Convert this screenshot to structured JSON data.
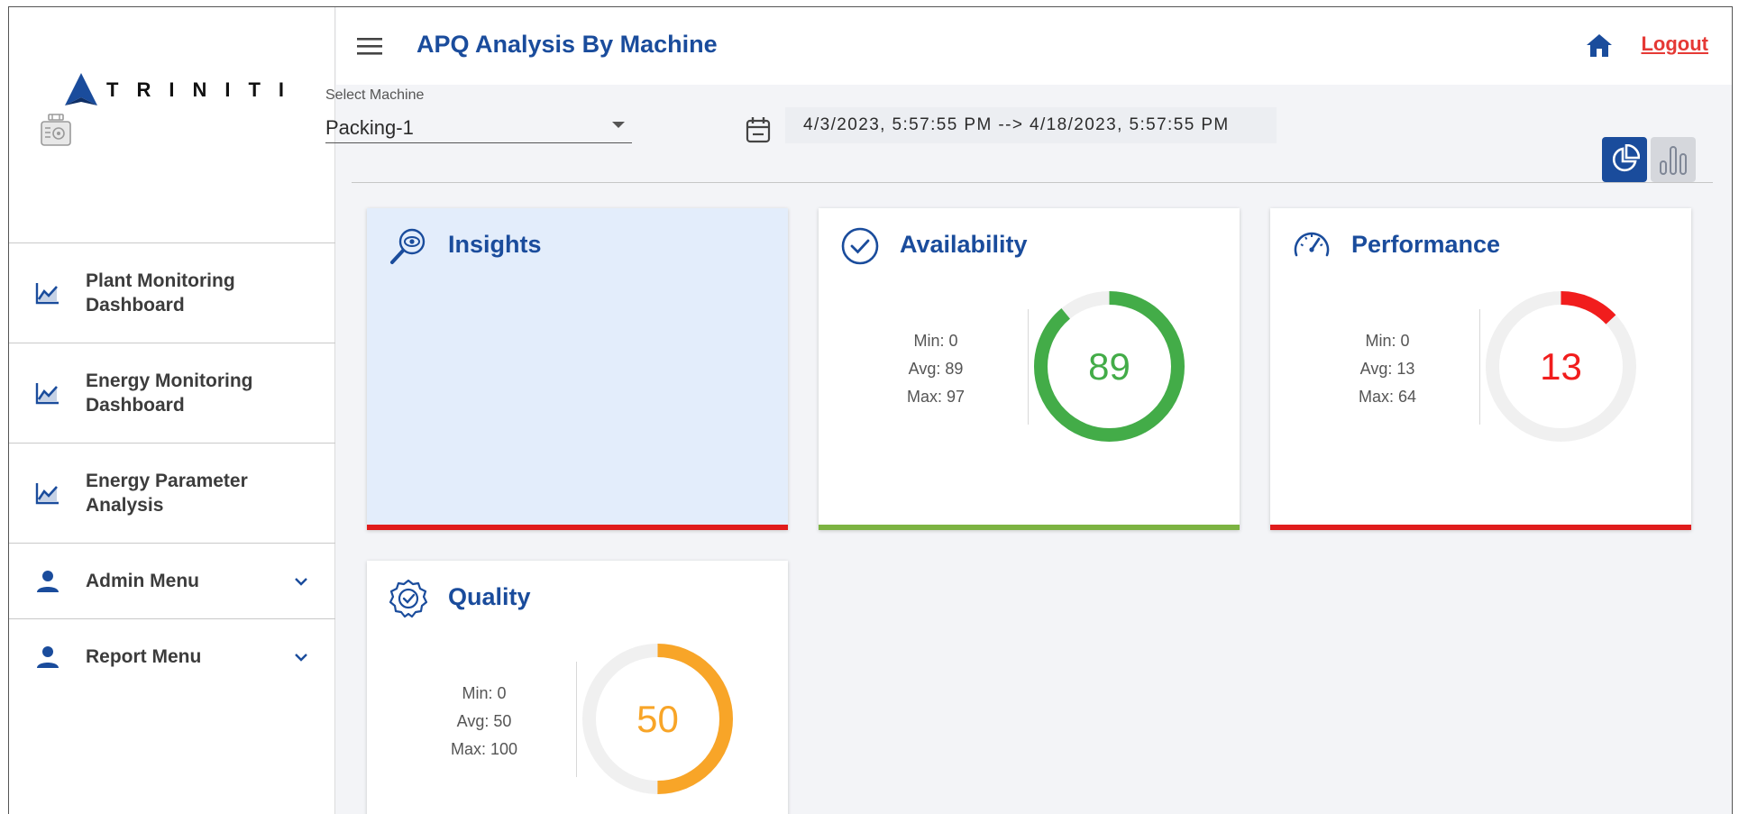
{
  "brand": {
    "name": "TRINITI"
  },
  "sidebar": {
    "items": [
      {
        "label": "Plant Monitoring Dashboard",
        "icon": "chart-line-icon"
      },
      {
        "label": "Energy Monitoring Dashboard",
        "icon": "chart-line-icon"
      },
      {
        "label": "Energy Parameter Analysis",
        "icon": "chart-line-icon"
      },
      {
        "label": "Admin Menu",
        "icon": "person-icon",
        "expandable": true
      },
      {
        "label": "Report Menu",
        "icon": "person-icon",
        "expandable": true
      }
    ]
  },
  "header": {
    "title": "APQ Analysis By Machine",
    "logout_label": "Logout"
  },
  "filters": {
    "machine_label": "Select Machine",
    "machine_value": "Packing-1",
    "date_range": "4/3/2023, 5:57:55 PM --> 4/18/2023, 5:57:55 PM"
  },
  "cards": {
    "insights": {
      "title": "Insights",
      "accent": "#e01c1c"
    },
    "availability": {
      "title": "Availability",
      "min": "Min: 0",
      "avg": "Avg: 89",
      "max": "Max: 97",
      "value": 89,
      "display": "89",
      "color": "#43ac48",
      "accent": "#7cb342"
    },
    "performance": {
      "title": "Performance",
      "min": "Min: 0",
      "avg": "Avg: 13",
      "max": "Max: 64",
      "value": 13,
      "display": "13",
      "color": "#f11d1d",
      "accent": "#e01c1c"
    },
    "quality": {
      "title": "Quality",
      "min": "Min: 0",
      "avg": "Avg: 50",
      "max": "Max: 100",
      "value": 50,
      "display": "50",
      "color": "#f8a528",
      "accent": "#f8a528"
    }
  },
  "colors": {
    "primary": "#1a4c9c",
    "logout": "#e53935",
    "gauge_track": "#f0f0f0"
  }
}
